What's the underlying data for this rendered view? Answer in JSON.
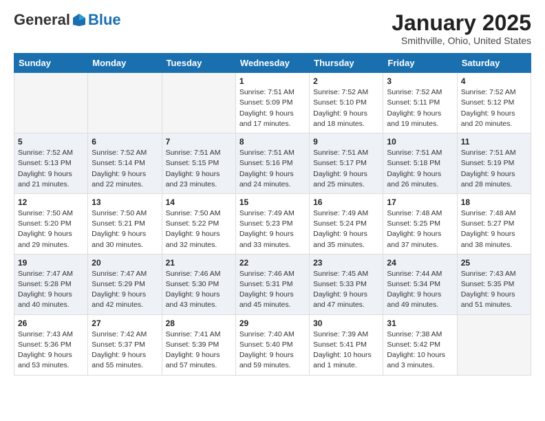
{
  "header": {
    "logo_general": "General",
    "logo_blue": "Blue",
    "month_title": "January 2025",
    "location": "Smithville, Ohio, United States"
  },
  "days_of_week": [
    "Sunday",
    "Monday",
    "Tuesday",
    "Wednesday",
    "Thursday",
    "Friday",
    "Saturday"
  ],
  "weeks": [
    {
      "shade": false,
      "days": [
        {
          "num": "",
          "info": "",
          "empty": true
        },
        {
          "num": "",
          "info": "",
          "empty": true
        },
        {
          "num": "",
          "info": "",
          "empty": true
        },
        {
          "num": "1",
          "info": "Sunrise: 7:51 AM\nSunset: 5:09 PM\nDaylight: 9 hours\nand 17 minutes.",
          "empty": false
        },
        {
          "num": "2",
          "info": "Sunrise: 7:52 AM\nSunset: 5:10 PM\nDaylight: 9 hours\nand 18 minutes.",
          "empty": false
        },
        {
          "num": "3",
          "info": "Sunrise: 7:52 AM\nSunset: 5:11 PM\nDaylight: 9 hours\nand 19 minutes.",
          "empty": false
        },
        {
          "num": "4",
          "info": "Sunrise: 7:52 AM\nSunset: 5:12 PM\nDaylight: 9 hours\nand 20 minutes.",
          "empty": false
        }
      ]
    },
    {
      "shade": true,
      "days": [
        {
          "num": "5",
          "info": "Sunrise: 7:52 AM\nSunset: 5:13 PM\nDaylight: 9 hours\nand 21 minutes.",
          "empty": false
        },
        {
          "num": "6",
          "info": "Sunrise: 7:52 AM\nSunset: 5:14 PM\nDaylight: 9 hours\nand 22 minutes.",
          "empty": false
        },
        {
          "num": "7",
          "info": "Sunrise: 7:51 AM\nSunset: 5:15 PM\nDaylight: 9 hours\nand 23 minutes.",
          "empty": false
        },
        {
          "num": "8",
          "info": "Sunrise: 7:51 AM\nSunset: 5:16 PM\nDaylight: 9 hours\nand 24 minutes.",
          "empty": false
        },
        {
          "num": "9",
          "info": "Sunrise: 7:51 AM\nSunset: 5:17 PM\nDaylight: 9 hours\nand 25 minutes.",
          "empty": false
        },
        {
          "num": "10",
          "info": "Sunrise: 7:51 AM\nSunset: 5:18 PM\nDaylight: 9 hours\nand 26 minutes.",
          "empty": false
        },
        {
          "num": "11",
          "info": "Sunrise: 7:51 AM\nSunset: 5:19 PM\nDaylight: 9 hours\nand 28 minutes.",
          "empty": false
        }
      ]
    },
    {
      "shade": false,
      "days": [
        {
          "num": "12",
          "info": "Sunrise: 7:50 AM\nSunset: 5:20 PM\nDaylight: 9 hours\nand 29 minutes.",
          "empty": false
        },
        {
          "num": "13",
          "info": "Sunrise: 7:50 AM\nSunset: 5:21 PM\nDaylight: 9 hours\nand 30 minutes.",
          "empty": false
        },
        {
          "num": "14",
          "info": "Sunrise: 7:50 AM\nSunset: 5:22 PM\nDaylight: 9 hours\nand 32 minutes.",
          "empty": false
        },
        {
          "num": "15",
          "info": "Sunrise: 7:49 AM\nSunset: 5:23 PM\nDaylight: 9 hours\nand 33 minutes.",
          "empty": false
        },
        {
          "num": "16",
          "info": "Sunrise: 7:49 AM\nSunset: 5:24 PM\nDaylight: 9 hours\nand 35 minutes.",
          "empty": false
        },
        {
          "num": "17",
          "info": "Sunrise: 7:48 AM\nSunset: 5:25 PM\nDaylight: 9 hours\nand 37 minutes.",
          "empty": false
        },
        {
          "num": "18",
          "info": "Sunrise: 7:48 AM\nSunset: 5:27 PM\nDaylight: 9 hours\nand 38 minutes.",
          "empty": false
        }
      ]
    },
    {
      "shade": true,
      "days": [
        {
          "num": "19",
          "info": "Sunrise: 7:47 AM\nSunset: 5:28 PM\nDaylight: 9 hours\nand 40 minutes.",
          "empty": false
        },
        {
          "num": "20",
          "info": "Sunrise: 7:47 AM\nSunset: 5:29 PM\nDaylight: 9 hours\nand 42 minutes.",
          "empty": false
        },
        {
          "num": "21",
          "info": "Sunrise: 7:46 AM\nSunset: 5:30 PM\nDaylight: 9 hours\nand 43 minutes.",
          "empty": false
        },
        {
          "num": "22",
          "info": "Sunrise: 7:46 AM\nSunset: 5:31 PM\nDaylight: 9 hours\nand 45 minutes.",
          "empty": false
        },
        {
          "num": "23",
          "info": "Sunrise: 7:45 AM\nSunset: 5:33 PM\nDaylight: 9 hours\nand 47 minutes.",
          "empty": false
        },
        {
          "num": "24",
          "info": "Sunrise: 7:44 AM\nSunset: 5:34 PM\nDaylight: 9 hours\nand 49 minutes.",
          "empty": false
        },
        {
          "num": "25",
          "info": "Sunrise: 7:43 AM\nSunset: 5:35 PM\nDaylight: 9 hours\nand 51 minutes.",
          "empty": false
        }
      ]
    },
    {
      "shade": false,
      "days": [
        {
          "num": "26",
          "info": "Sunrise: 7:43 AM\nSunset: 5:36 PM\nDaylight: 9 hours\nand 53 minutes.",
          "empty": false
        },
        {
          "num": "27",
          "info": "Sunrise: 7:42 AM\nSunset: 5:37 PM\nDaylight: 9 hours\nand 55 minutes.",
          "empty": false
        },
        {
          "num": "28",
          "info": "Sunrise: 7:41 AM\nSunset: 5:39 PM\nDaylight: 9 hours\nand 57 minutes.",
          "empty": false
        },
        {
          "num": "29",
          "info": "Sunrise: 7:40 AM\nSunset: 5:40 PM\nDaylight: 9 hours\nand 59 minutes.",
          "empty": false
        },
        {
          "num": "30",
          "info": "Sunrise: 7:39 AM\nSunset: 5:41 PM\nDaylight: 10 hours\nand 1 minute.",
          "empty": false
        },
        {
          "num": "31",
          "info": "Sunrise: 7:38 AM\nSunset: 5:42 PM\nDaylight: 10 hours\nand 3 minutes.",
          "empty": false
        },
        {
          "num": "",
          "info": "",
          "empty": true
        }
      ]
    }
  ]
}
